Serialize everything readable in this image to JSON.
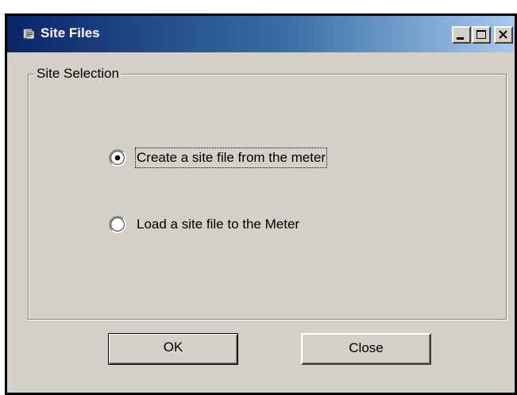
{
  "window": {
    "title": "Site Files",
    "controls": {
      "minimize": "minimize-icon",
      "maximize": "maximize-icon",
      "close": "close-icon"
    }
  },
  "site_selection": {
    "group_label": "Site Selection",
    "options": [
      {
        "label": "Create a site file from the meter",
        "selected": true
      },
      {
        "label": "Load a site file to the Meter",
        "selected": false
      }
    ]
  },
  "buttons": {
    "ok_label": "OK",
    "close_label": "Close"
  },
  "colors": {
    "dialog_face": "#d4d0c8",
    "titlebar_start": "#0a246a",
    "titlebar_end": "#a6caf0",
    "title_text": "#ffffff"
  }
}
